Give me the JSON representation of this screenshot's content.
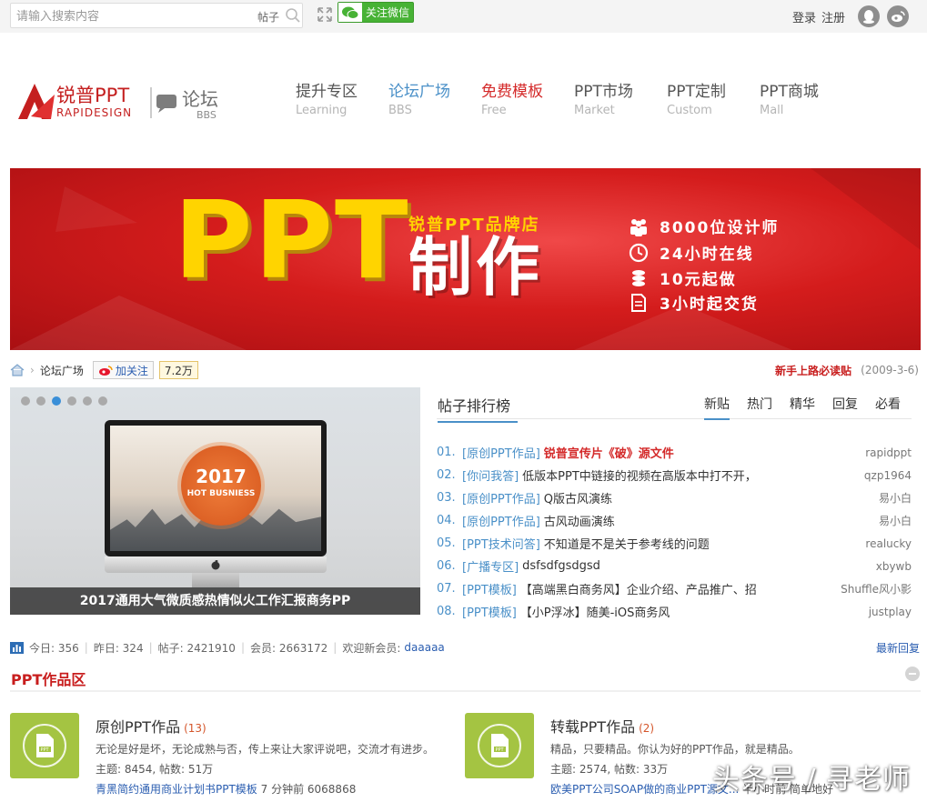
{
  "topbar": {
    "search_placeholder": "请输入搜索内容",
    "search_scope": "帖子",
    "wechat_label": "关注微信",
    "login": "登录",
    "register": "注册"
  },
  "nav": [
    {
      "cn": "提升专区",
      "en": "Learning"
    },
    {
      "cn": "论坛广场",
      "en": "BBS"
    },
    {
      "cn": "免费模板",
      "en": "Free"
    },
    {
      "cn": "PPT市场",
      "en": "Market"
    },
    {
      "cn": "PPT定制",
      "en": "Custom"
    },
    {
      "cn": "PPT商城",
      "en": "Mall"
    }
  ],
  "banner": {
    "ppt": "PPT",
    "brand": "锐普PPT品牌店",
    "make": "制作",
    "features": [
      "8000位设计师",
      "24小时在线",
      "10元起做",
      "3小时起交货"
    ]
  },
  "crumbs": {
    "page": "论坛广场",
    "follow": "加关注",
    "followers": "7.2万",
    "newbie": "新手上路必读贴",
    "date": "(2009-3-6)"
  },
  "slider": {
    "badge_year": "2017",
    "badge_text": "HOT BUSNIESS",
    "caption": "2017通用大气微质感热情似火工作汇报商务PP"
  },
  "ranking": {
    "title": "帖子排行榜",
    "tabs": [
      "新贴",
      "热门",
      "精华",
      "回复",
      "必看"
    ],
    "rows": [
      {
        "num": "01.",
        "tag": "[原创PPT作品]",
        "title": "锐普宣传片《破》源文件",
        "author": "rapidppt"
      },
      {
        "num": "02.",
        "tag": "[你问我答]",
        "title": "低版本PPT中链接的视频在高版本中打不开，",
        "author": "qzp1964"
      },
      {
        "num": "03.",
        "tag": "[原创PPT作品]",
        "title": "Q版古风演练",
        "author": "易小白"
      },
      {
        "num": "04.",
        "tag": "[原创PPT作品]",
        "title": "古风动画演练",
        "author": "易小白"
      },
      {
        "num": "05.",
        "tag": "[PPT技术问答]",
        "title": "不知道是不是关于参考线的问题",
        "author": "realucky"
      },
      {
        "num": "06.",
        "tag": "[广播专区]",
        "title": "dsfsdfgsdgsd",
        "author": "xbywb"
      },
      {
        "num": "07.",
        "tag": "[PPT模板]",
        "title": "【高端黑白商务风】企业介绍、产品推广、招",
        "author": "Shuffle风小影"
      },
      {
        "num": "08.",
        "tag": "[PPT模板]",
        "title": "【小P浮冰】随美-iOS商务风",
        "author": "justplay"
      }
    ]
  },
  "stats": {
    "today": "今日: 356",
    "yesterday": "昨日: 324",
    "posts": "帖子: 2421910",
    "members": "会员: 2663172",
    "welcome": "欢迎新会员:",
    "new_member": "daaaaa",
    "latest": "最新回复"
  },
  "section": {
    "title": "PPT作品区",
    "forums": [
      {
        "name": "原创PPT作品",
        "count": "(13)",
        "desc": "无论是好是坏，无论成熟与否，传上来让大家评说吧，交流才有进步。",
        "meta": "主题: 8454, 帖数: 51万",
        "last_title": "青黑简约通用商业计划书PPT模板",
        "last_info": " 7 分钟前 6068868"
      },
      {
        "name": "转载PPT作品",
        "count": "(2)",
        "desc": "精品，只要精品。你认为好的PPT作品，就是精品。",
        "meta": "主题: 2574, 帖数: 33万",
        "last_title": "欧美PPT公司SOAP做的商业PPT源文...",
        "last_info": " 半小时前 简单地好"
      }
    ]
  },
  "watermark": "头条号 / 寻老师",
  "colors": {
    "accent": "#4a90c8",
    "red": "#c81e1e",
    "wechat": "#47b235",
    "forum_icon": "#a4c442"
  }
}
